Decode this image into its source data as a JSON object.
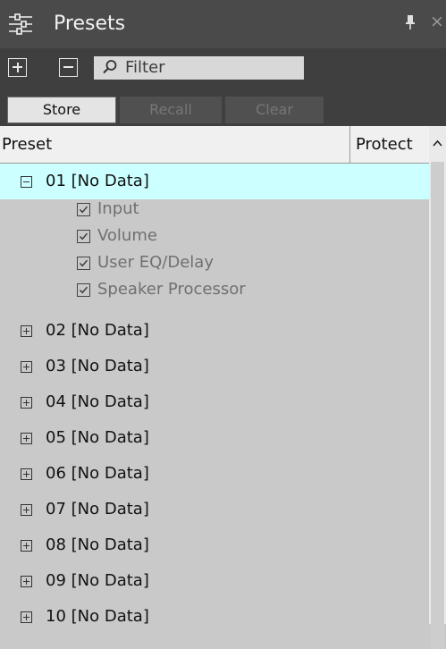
{
  "panel": {
    "title": "Presets",
    "title_icon": "sliders-icon",
    "pin_icon": "pin-icon",
    "close_glyph": "×"
  },
  "toolbar": {
    "expand_all_icon": "plus-square-icon",
    "collapse_all_icon": "minus-square-icon",
    "filter_icon": "magnifier-icon",
    "filter_placeholder": "Filter",
    "store_label": "Store",
    "recall_label": "Recall",
    "clear_label": "Clear"
  },
  "table": {
    "columns": [
      "Preset",
      "Protect"
    ],
    "rows": [
      {
        "label": "01 [No Data]",
        "expanded": true,
        "selected": true,
        "children": [
          {
            "label": "Input",
            "checked": true
          },
          {
            "label": "Volume",
            "checked": true
          },
          {
            "label": "User EQ/Delay",
            "checked": true
          },
          {
            "label": "Speaker Processor",
            "checked": true
          }
        ]
      },
      {
        "label": "02 [No Data]",
        "expanded": false
      },
      {
        "label": "03 [No Data]",
        "expanded": false
      },
      {
        "label": "04 [No Data]",
        "expanded": false
      },
      {
        "label": "05 [No Data]",
        "expanded": false
      },
      {
        "label": "06 [No Data]",
        "expanded": false
      },
      {
        "label": "07 [No Data]",
        "expanded": false
      },
      {
        "label": "08 [No Data]",
        "expanded": false
      },
      {
        "label": "09 [No Data]",
        "expanded": false
      },
      {
        "label": "10 [No Data]",
        "expanded": false
      }
    ]
  },
  "colors": {
    "selected_row": "#ccffff",
    "title_bar": "#4a4a4a",
    "toolbar": "#3f3f3f",
    "list_background": "#c9c9c9"
  }
}
